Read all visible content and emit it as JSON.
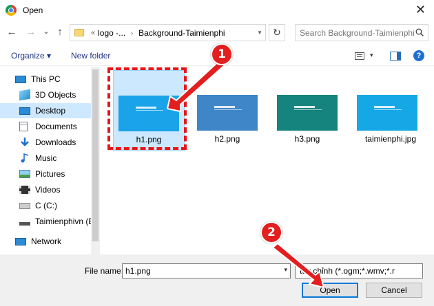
{
  "window": {
    "title": "Open",
    "close_glyph": "✕"
  },
  "nav": {
    "back": "←",
    "forward": "→",
    "recent": "⌄",
    "up": "↑"
  },
  "address": {
    "overflow": "«",
    "parent": "logo -...",
    "sep": "›",
    "current": "Background-Taimienphi",
    "dropdown": "▾",
    "refresh": "↻"
  },
  "search": {
    "placeholder": "Search Background-Taimienphi"
  },
  "toolbar": {
    "organize": "Organize ▾",
    "new_folder": "New folder",
    "view_caret": "▾",
    "help": "?"
  },
  "sidebar": {
    "items": [
      {
        "label": "This PC",
        "icon": "pc-icon"
      },
      {
        "label": "3D Objects",
        "icon": "cube-icon"
      },
      {
        "label": "Desktop",
        "icon": "desktop-icon",
        "selected": true
      },
      {
        "label": "Documents",
        "icon": "documents-icon"
      },
      {
        "label": "Downloads",
        "icon": "download-icon"
      },
      {
        "label": "Music",
        "icon": "music-icon"
      },
      {
        "label": "Pictures",
        "icon": "pictures-icon"
      },
      {
        "label": "Videos",
        "icon": "videos-icon"
      },
      {
        "label": "C (C:)",
        "icon": "drive-icon"
      },
      {
        "label": "Taimienphivn (E:",
        "icon": "usb-drive-icon"
      },
      {
        "label": "Network",
        "icon": "network-icon"
      }
    ]
  },
  "files": [
    {
      "name": "h1.png",
      "color": "#1aa3e8",
      "selected": true
    },
    {
      "name": "h2.png",
      "color": "#3f86c8"
    },
    {
      "name": "h3.png",
      "color": "#15847f"
    },
    {
      "name": "taimienphi.jpg",
      "color": "#16a8e6"
    }
  ],
  "bottom": {
    "file_name_label": "File name:",
    "file_name_value": "h1.png",
    "file_type": "tùy chỉnh (*.ogm;*.wmv;*.r",
    "open_label": "Open",
    "cancel_label": "Cancel"
  },
  "annotations": {
    "step1": "1",
    "step2": "2"
  },
  "colors": {
    "accent": "#0078d7",
    "annotation_red": "#e41e1e",
    "selection": "#cce8ff"
  }
}
